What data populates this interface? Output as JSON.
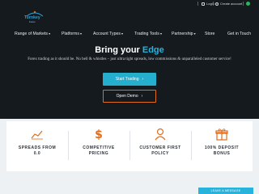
{
  "topbar": {
    "login_label": "Login",
    "create_account_label": "Create account"
  },
  "logo": {
    "name": "Turnkey",
    "tagline": "Forex"
  },
  "nav": {
    "items": [
      {
        "label": "Range of Markets"
      },
      {
        "label": "Platforms"
      },
      {
        "label": "Account Types"
      },
      {
        "label": "Trading Tools"
      },
      {
        "label": "Partnership"
      },
      {
        "label": "Store"
      },
      {
        "label": "Get in Touch"
      }
    ]
  },
  "hero": {
    "title_main": "Bring your ",
    "title_highlight": "Edge",
    "subtitle": "Forex trading as it should be. No bell & whistles – just ultra tight spreads, low commissions & unparalleled customer service!",
    "start_button": "Start Trading",
    "demo_button": "Open Demo"
  },
  "features": [
    {
      "icon": "chart-icon",
      "line1": "SPREADS FROM",
      "line2": "0.0"
    },
    {
      "icon": "dollar-icon",
      "line1": "COMPETITIVE",
      "line2": "PRICING"
    },
    {
      "icon": "user-icon",
      "line1": "CUSTOMER FIRST",
      "line2": "POLICY"
    },
    {
      "icon": "gift-icon",
      "line1": "100% DEPOSIT",
      "line2": "BONUS"
    }
  ],
  "leave_message_label": "LEAVE A MESSAGE",
  "colors": {
    "hero_bg": "#151a1f",
    "accent_blue": "#27b3dc",
    "accent_orange": "#e06d1c",
    "feature_bg": "#eef1f4"
  }
}
